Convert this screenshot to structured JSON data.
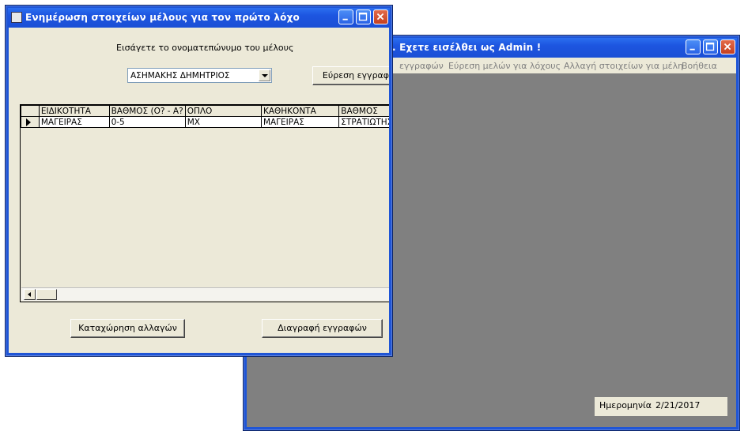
{
  "back_window": {
    "title": ". Εχετε εισέλθει ως Admin !",
    "menu": [
      "εγγραφών",
      "Εύρεση μελών για λόχους",
      "Αλλαγή στοιχείων για μέλη",
      "Βοήθεια"
    ],
    "date_label": "Ημερομηνία",
    "date_value": "2/21/2017"
  },
  "front_window": {
    "title": "Ενημέρωση στοιχείων μέλους για τον πρώτο λόχο",
    "prompt": "Εισάγετε το ονοματεπώνυμο του μέλους",
    "member_select": {
      "value": "ΑΣΗΜΑΚΗΣ ΔΗΜΗΤΡΙΟΣ"
    },
    "search_button": "Εύρεση εγγραφ",
    "grid": {
      "columns": [
        "ΕΙΔΙΚΟΤΗΤΑ",
        "ΒΑΘΜΟΣ (Ο? - Α?",
        "ΟΠΛΟ",
        "ΚΑΘΗΚΟΝΤΑ",
        "ΒΑΘΜΟΣ"
      ],
      "rows": [
        [
          "ΜΑΓΕΙΡΑΣ",
          "0-5",
          "ΜΧ",
          "ΜΑΓΕΙΡΑΣ",
          "ΣΤΡΑΤΙΩΤΗΣ"
        ]
      ]
    },
    "save_button": "Καταχώρηση αλλαγών",
    "delete_button": "Διαγραφή εγγραφών"
  },
  "colors": {
    "titlebar": "#1d55e0",
    "client_back": "#808080",
    "client_front": "#ece9d8"
  }
}
